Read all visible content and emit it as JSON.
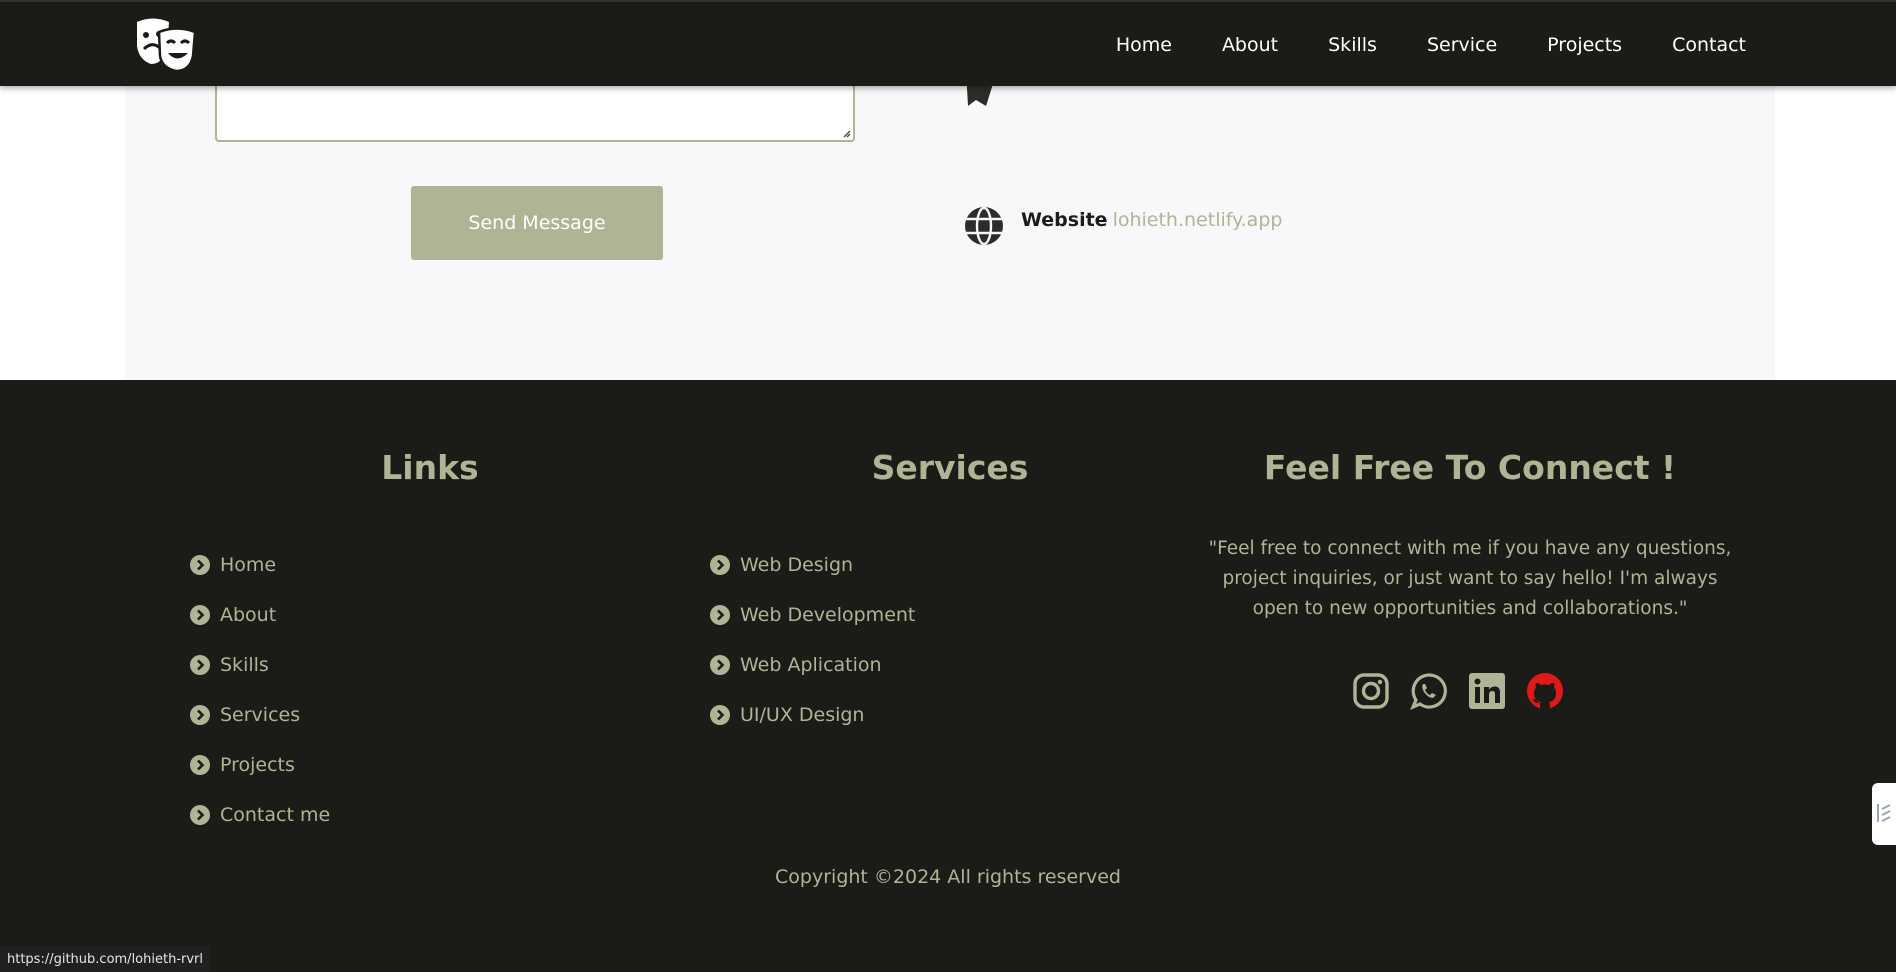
{
  "header": {
    "logo": "theater-masks-icon",
    "nav": [
      "Home",
      "About",
      "Skills",
      "Service",
      "Projects",
      "Contact"
    ]
  },
  "contact": {
    "send_button": "Send Message",
    "website_label": "Website",
    "website_value": "lohieth.netlify.app"
  },
  "footer": {
    "links_title": "Links",
    "links": [
      "Home",
      "About",
      "Skills",
      "Services",
      "Projects",
      "Contact me"
    ],
    "services_title": "Services",
    "services": [
      "Web Design",
      "Web Development",
      "Web Aplication",
      "UI/UX Design"
    ],
    "connect_title": "Feel Free To Connect !",
    "connect_text": "\"Feel free to connect with me if you have any questions, project inquiries, or just want to say hello! I'm always open to new opportunities and collaborations.\"",
    "social_icons": [
      "instagram-icon",
      "whatsapp-icon",
      "linkedin-icon",
      "github-icon"
    ],
    "copyright": "Copyright ©2024 All rights reserved"
  },
  "status_bar": {
    "url": "https://github.com/lohieth-rvrl"
  },
  "colors": {
    "dark": "#1b1b18",
    "accent": "#b0b494",
    "github_red": "#e11919"
  }
}
